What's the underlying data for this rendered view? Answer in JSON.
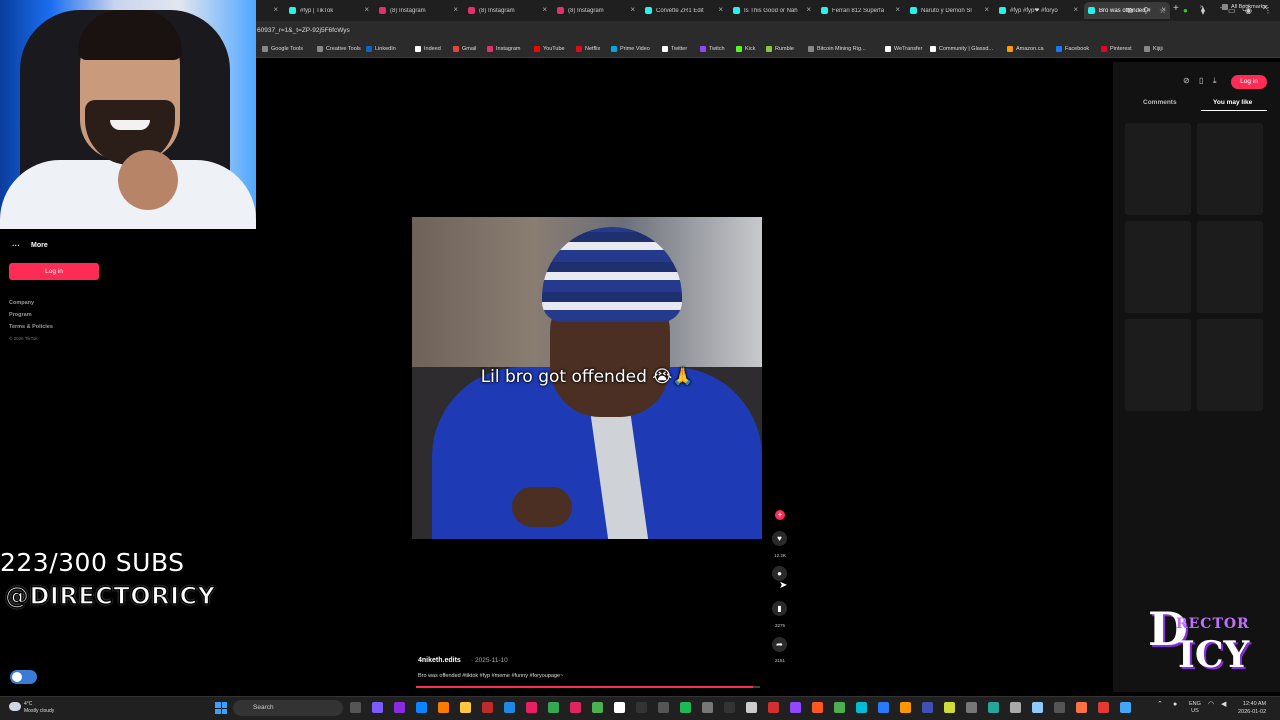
{
  "browser": {
    "tabs": [
      {
        "label": "#fyp | TikTok",
        "color": "#25f4ee"
      },
      {
        "label": "(8) Instagram",
        "color": "#e1306c"
      },
      {
        "label": "(8) Instagram",
        "color": "#e1306c"
      },
      {
        "label": "(8) Instagram",
        "color": "#e1306c"
      },
      {
        "label": "Corvette ZR1 Edit",
        "color": "#25f4ee"
      },
      {
        "label": "Is This Good or Nah",
        "color": "#25f4ee"
      },
      {
        "label": "Ferrari 812 Superfa",
        "color": "#25f4ee"
      },
      {
        "label": "Naruto y Demon Sl",
        "color": "#25f4ee"
      },
      {
        "label": "#fyp #fyp❤ #foryo",
        "color": "#25f4ee"
      },
      {
        "label": "Bro was offended #",
        "color": "#25f4ee",
        "active": true
      }
    ],
    "url": "60937_r=1&_t=ZP-92j5F6fcWys",
    "bookmarks": [
      {
        "label": "Google Tools",
        "color": "#888"
      },
      {
        "label": "Creative Tools",
        "color": "#888"
      },
      {
        "label": "LinkedIn",
        "color": "#0a66c2"
      },
      {
        "label": "Indeed",
        "color": "#ffffff"
      },
      {
        "label": "Gmail",
        "color": "#ea4335"
      },
      {
        "label": "Instagram",
        "color": "#e1306c"
      },
      {
        "label": "YouTube",
        "color": "#ff0000"
      },
      {
        "label": "Netflix",
        "color": "#e50914"
      },
      {
        "label": "Prime Video",
        "color": "#00a8e1"
      },
      {
        "label": "Twitter",
        "color": "#ffffff"
      },
      {
        "label": "Twitch",
        "color": "#9146ff"
      },
      {
        "label": "Kick",
        "color": "#53fc18"
      },
      {
        "label": "Rumble",
        "color": "#85c742"
      },
      {
        "label": "Bitcoin Mining Rig...",
        "color": "#888"
      },
      {
        "label": "WeTransfer",
        "color": "#ffffff"
      },
      {
        "label": "Community | Glassd...",
        "color": "#ffffff"
      },
      {
        "label": "Amazon.ca",
        "color": "#ff9900"
      },
      {
        "label": "Facebook",
        "color": "#1877f2"
      },
      {
        "label": "Pinterest",
        "color": "#e60023"
      },
      {
        "label": "Kijiji",
        "color": "#888"
      }
    ],
    "all_bookmarks": "All Bookmarks"
  },
  "sidebar": {
    "more": "More",
    "login": "Log in",
    "footer": [
      "Company",
      "Program",
      "Terms & Policies"
    ],
    "copyright": "© 2026 TikTok"
  },
  "overlay": {
    "subs": "223/300 SUBS",
    "handle": "@DIRECTORICY",
    "logo_main": "D",
    "logo_text": "RECTOR",
    "logo_sub": "ICY"
  },
  "video": {
    "caption": "Lil bro got offended 😭🙏",
    "username": "4niketh.edits",
    "date": "· 2025-11-10",
    "description": "Bro was offended #tiktok #fyp #meme #funny #foryoupage~",
    "progress": 0.98,
    "likes": "12.2K",
    "saves": "3275",
    "shares": "2151"
  },
  "right_panel": {
    "login": "Log in",
    "tabs": [
      "Comments",
      "You may like"
    ]
  },
  "taskbar": {
    "weather_temp": "4°C",
    "weather_desc": "Mostly cloudy",
    "search": "Search",
    "lang": "ENG",
    "region": "US",
    "time": "12:40 AM",
    "date": "2026-01-02"
  }
}
